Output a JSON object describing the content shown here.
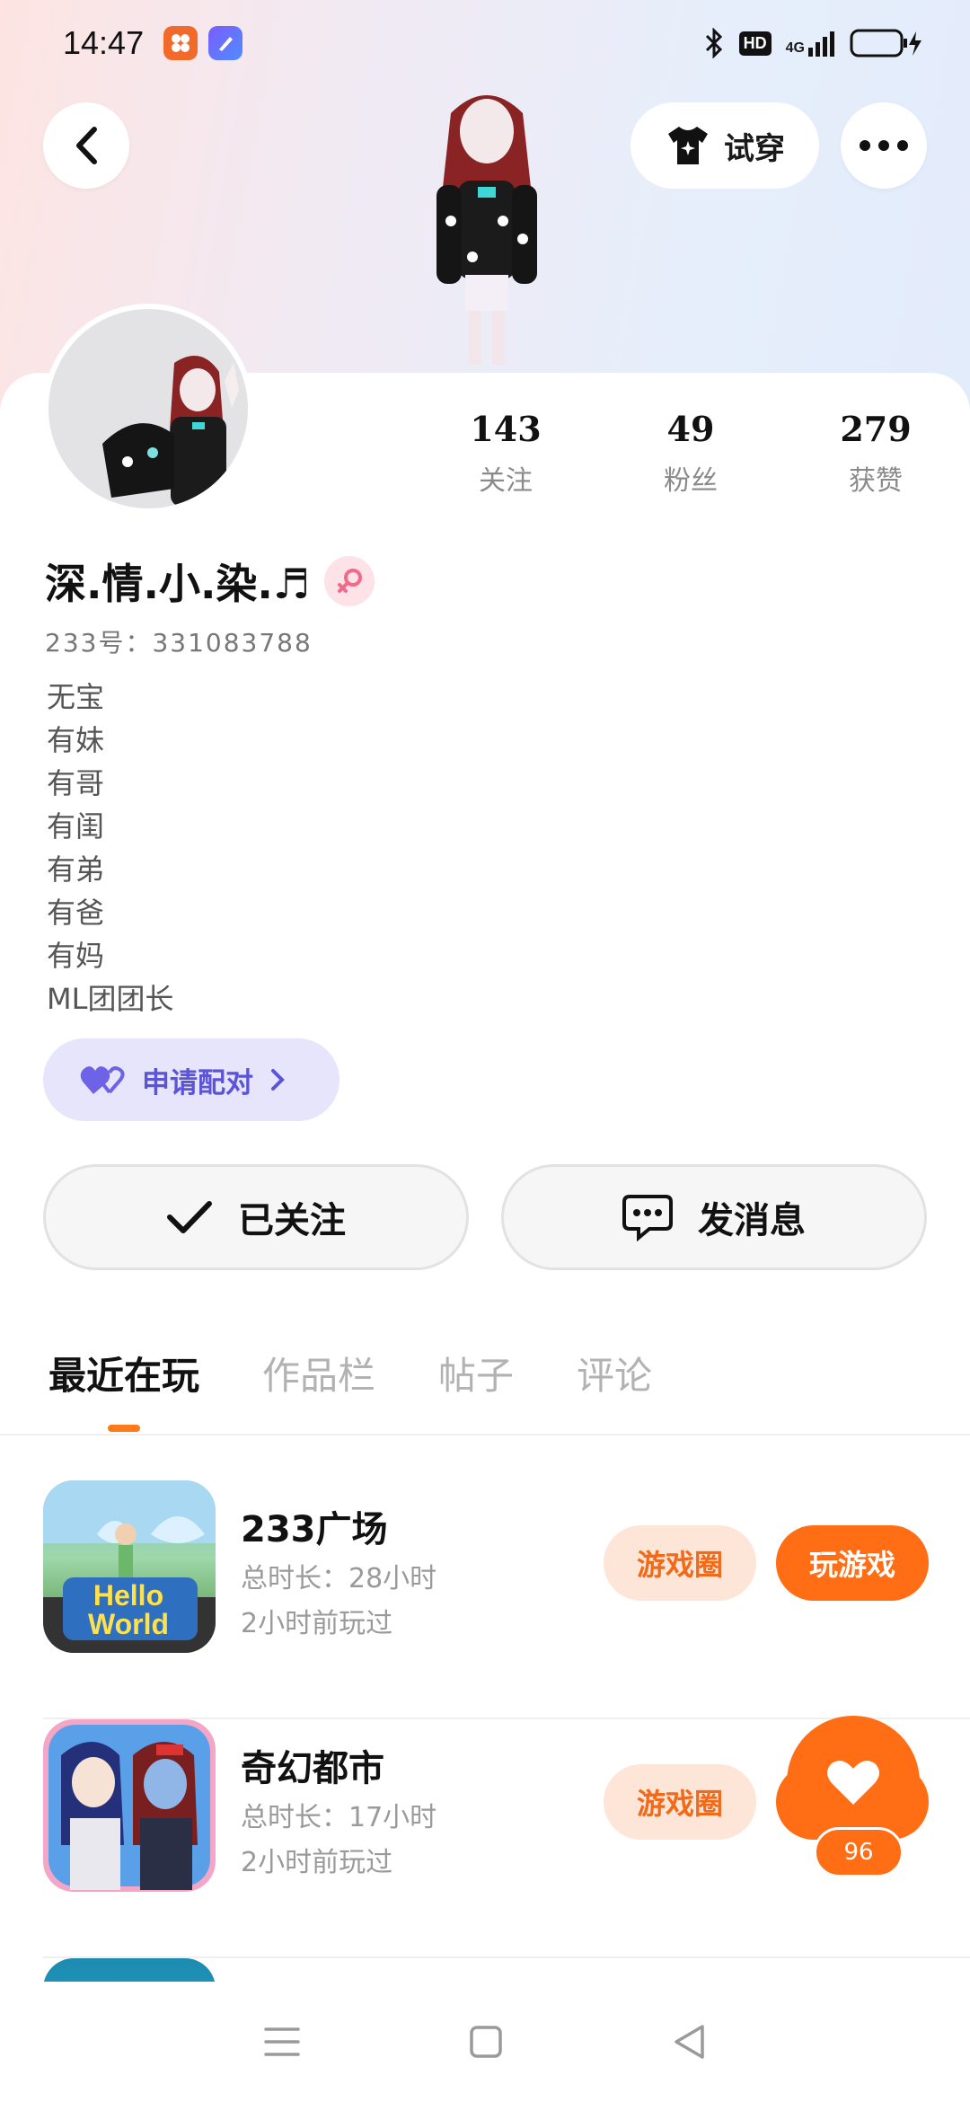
{
  "status_bar": {
    "time": "14:47",
    "network": "4G",
    "hd": "HD"
  },
  "header": {
    "try_on_label": "试穿"
  },
  "profile": {
    "stats": [
      {
        "value": "143",
        "label": "关注"
      },
      {
        "value": "49",
        "label": "粉丝"
      },
      {
        "value": "279",
        "label": "获赞"
      }
    ],
    "username": "深.情.小.染.♬",
    "user_id": "233号：331083788",
    "bio_lines": [
      "无宝",
      "有妹",
      "有哥",
      "有闺",
      "有弟",
      "有爸",
      "有妈",
      "ML团团长"
    ],
    "pair_button": "申请配对",
    "followed_button": "已关注",
    "message_button": "发消息"
  },
  "tabs": [
    "最近在玩",
    "作品栏",
    "帖子",
    "评论"
  ],
  "games": [
    {
      "name": "233广场",
      "duration": "总时长：28小时",
      "last_played": "2小时前玩过",
      "icon_text": "Hello World",
      "circle_label": "游戏圈",
      "play_label": "玩游戏"
    },
    {
      "name": "奇幻都市",
      "duration": "总时长：17小时",
      "last_played": "2小时前玩过",
      "circle_label": "游戏圈"
    }
  ],
  "like_float": {
    "count": "96"
  },
  "colors": {
    "accent_orange": "#ff6e14",
    "pair_purple": "#5b54d6"
  }
}
